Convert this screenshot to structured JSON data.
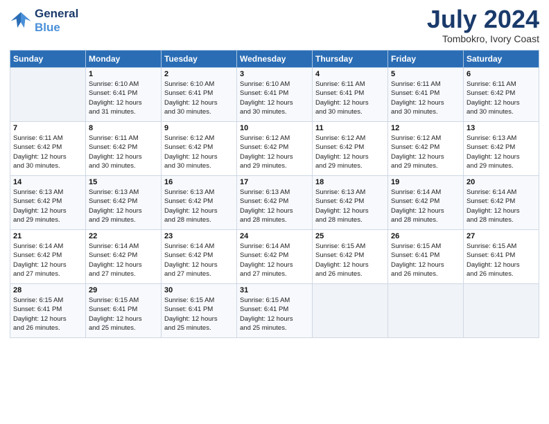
{
  "header": {
    "logo_line1": "General",
    "logo_line2": "Blue",
    "month": "July 2024",
    "location": "Tombokro, Ivory Coast"
  },
  "weekdays": [
    "Sunday",
    "Monday",
    "Tuesday",
    "Wednesday",
    "Thursday",
    "Friday",
    "Saturday"
  ],
  "weeks": [
    [
      {
        "day": "",
        "info": ""
      },
      {
        "day": "1",
        "info": "Sunrise: 6:10 AM\nSunset: 6:41 PM\nDaylight: 12 hours\nand 31 minutes."
      },
      {
        "day": "2",
        "info": "Sunrise: 6:10 AM\nSunset: 6:41 PM\nDaylight: 12 hours\nand 30 minutes."
      },
      {
        "day": "3",
        "info": "Sunrise: 6:10 AM\nSunset: 6:41 PM\nDaylight: 12 hours\nand 30 minutes."
      },
      {
        "day": "4",
        "info": "Sunrise: 6:11 AM\nSunset: 6:41 PM\nDaylight: 12 hours\nand 30 minutes."
      },
      {
        "day": "5",
        "info": "Sunrise: 6:11 AM\nSunset: 6:41 PM\nDaylight: 12 hours\nand 30 minutes."
      },
      {
        "day": "6",
        "info": "Sunrise: 6:11 AM\nSunset: 6:42 PM\nDaylight: 12 hours\nand 30 minutes."
      }
    ],
    [
      {
        "day": "7",
        "info": "Sunrise: 6:11 AM\nSunset: 6:42 PM\nDaylight: 12 hours\nand 30 minutes."
      },
      {
        "day": "8",
        "info": "Sunrise: 6:11 AM\nSunset: 6:42 PM\nDaylight: 12 hours\nand 30 minutes."
      },
      {
        "day": "9",
        "info": "Sunrise: 6:12 AM\nSunset: 6:42 PM\nDaylight: 12 hours\nand 30 minutes."
      },
      {
        "day": "10",
        "info": "Sunrise: 6:12 AM\nSunset: 6:42 PM\nDaylight: 12 hours\nand 29 minutes."
      },
      {
        "day": "11",
        "info": "Sunrise: 6:12 AM\nSunset: 6:42 PM\nDaylight: 12 hours\nand 29 minutes."
      },
      {
        "day": "12",
        "info": "Sunrise: 6:12 AM\nSunset: 6:42 PM\nDaylight: 12 hours\nand 29 minutes."
      },
      {
        "day": "13",
        "info": "Sunrise: 6:13 AM\nSunset: 6:42 PM\nDaylight: 12 hours\nand 29 minutes."
      }
    ],
    [
      {
        "day": "14",
        "info": "Sunrise: 6:13 AM\nSunset: 6:42 PM\nDaylight: 12 hours\nand 29 minutes."
      },
      {
        "day": "15",
        "info": "Sunrise: 6:13 AM\nSunset: 6:42 PM\nDaylight: 12 hours\nand 29 minutes."
      },
      {
        "day": "16",
        "info": "Sunrise: 6:13 AM\nSunset: 6:42 PM\nDaylight: 12 hours\nand 28 minutes."
      },
      {
        "day": "17",
        "info": "Sunrise: 6:13 AM\nSunset: 6:42 PM\nDaylight: 12 hours\nand 28 minutes."
      },
      {
        "day": "18",
        "info": "Sunrise: 6:13 AM\nSunset: 6:42 PM\nDaylight: 12 hours\nand 28 minutes."
      },
      {
        "day": "19",
        "info": "Sunrise: 6:14 AM\nSunset: 6:42 PM\nDaylight: 12 hours\nand 28 minutes."
      },
      {
        "day": "20",
        "info": "Sunrise: 6:14 AM\nSunset: 6:42 PM\nDaylight: 12 hours\nand 28 minutes."
      }
    ],
    [
      {
        "day": "21",
        "info": "Sunrise: 6:14 AM\nSunset: 6:42 PM\nDaylight: 12 hours\nand 27 minutes."
      },
      {
        "day": "22",
        "info": "Sunrise: 6:14 AM\nSunset: 6:42 PM\nDaylight: 12 hours\nand 27 minutes."
      },
      {
        "day": "23",
        "info": "Sunrise: 6:14 AM\nSunset: 6:42 PM\nDaylight: 12 hours\nand 27 minutes."
      },
      {
        "day": "24",
        "info": "Sunrise: 6:14 AM\nSunset: 6:42 PM\nDaylight: 12 hours\nand 27 minutes."
      },
      {
        "day": "25",
        "info": "Sunrise: 6:15 AM\nSunset: 6:42 PM\nDaylight: 12 hours\nand 26 minutes."
      },
      {
        "day": "26",
        "info": "Sunrise: 6:15 AM\nSunset: 6:41 PM\nDaylight: 12 hours\nand 26 minutes."
      },
      {
        "day": "27",
        "info": "Sunrise: 6:15 AM\nSunset: 6:41 PM\nDaylight: 12 hours\nand 26 minutes."
      }
    ],
    [
      {
        "day": "28",
        "info": "Sunrise: 6:15 AM\nSunset: 6:41 PM\nDaylight: 12 hours\nand 26 minutes."
      },
      {
        "day": "29",
        "info": "Sunrise: 6:15 AM\nSunset: 6:41 PM\nDaylight: 12 hours\nand 25 minutes."
      },
      {
        "day": "30",
        "info": "Sunrise: 6:15 AM\nSunset: 6:41 PM\nDaylight: 12 hours\nand 25 minutes."
      },
      {
        "day": "31",
        "info": "Sunrise: 6:15 AM\nSunset: 6:41 PM\nDaylight: 12 hours\nand 25 minutes."
      },
      {
        "day": "",
        "info": ""
      },
      {
        "day": "",
        "info": ""
      },
      {
        "day": "",
        "info": ""
      }
    ]
  ]
}
